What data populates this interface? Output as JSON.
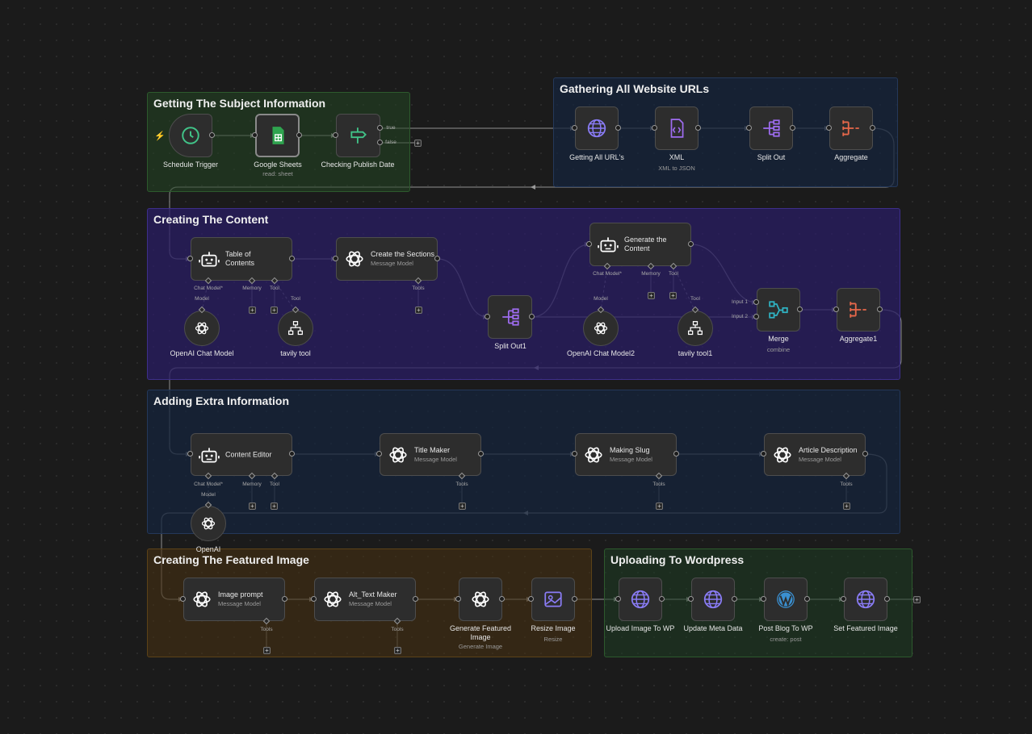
{
  "colors": {
    "canvas": "#1b1b1b",
    "wire": "#7a7a7a",
    "openai": "#ffffff",
    "http": "#8a7cf6",
    "sheets": "#2fa44f",
    "trigger": "#41c388",
    "filter": "#41c388",
    "split": "#9e6cf0",
    "aggregate": "#e8684a",
    "merge": "#2fb4c4"
  },
  "sections": {
    "subject": {
      "title": "Getting The Subject Information"
    },
    "urls": {
      "title": "Gathering All Website URLs"
    },
    "content": {
      "title": "Creating The Content"
    },
    "extra": {
      "title": "Adding Extra Information"
    },
    "image": {
      "title": "Creating The Featured Image"
    },
    "wordpress": {
      "title": "Uploading To Wordpress"
    }
  },
  "nodes": {
    "schedule": {
      "label": "Schedule Trigger",
      "icon": "clock-icon"
    },
    "sheets": {
      "label": "Google Sheets",
      "sub": "read: sheet",
      "icon": "google-sheets-icon"
    },
    "publish": {
      "label": "Checking Publish Date",
      "icon": "signpost-icon",
      "out_true": "true",
      "out_false": "false"
    },
    "get_urls": {
      "label": "Getting All URL's",
      "icon": "globe-icon"
    },
    "xml": {
      "label": "XML",
      "sub": "XML to JSON",
      "icon": "xml-icon"
    },
    "split1": {
      "label": "Split Out",
      "icon": "split-icon"
    },
    "aggregate": {
      "label": "Aggregate",
      "icon": "aggregate-icon"
    },
    "toc": {
      "label": "Table of Contents",
      "icon": "robot-icon"
    },
    "sections_node": {
      "label": "Create the Sections",
      "sub": "Message Model",
      "icon": "openai-icon"
    },
    "split2": {
      "label": "Split Out1",
      "icon": "split-icon"
    },
    "generate": {
      "label": "Generate the Content",
      "icon": "robot-icon"
    },
    "merge": {
      "label": "Merge",
      "sub": "combine",
      "input1": "Input 1",
      "input2": "Input 2",
      "icon": "merge-icon"
    },
    "aggregate1": {
      "label": "Aggregate1",
      "icon": "aggregate-icon"
    },
    "openai_chat": {
      "label": "OpenAI Chat Model",
      "icon": "openai-icon"
    },
    "tavily": {
      "label": "tavily tool",
      "icon": "sitemap-icon"
    },
    "openai_chat2": {
      "label": "OpenAI Chat Model2",
      "icon": "openai-icon"
    },
    "tavily1": {
      "label": "tavily tool1",
      "icon": "sitemap-icon"
    },
    "editor": {
      "label": "Content Editor",
      "icon": "robot-icon"
    },
    "title_maker": {
      "label": "Title Maker",
      "sub": "Message Model",
      "icon": "openai-icon"
    },
    "slug": {
      "label": "Making Slug",
      "sub": "Message Model",
      "icon": "openai-icon"
    },
    "description": {
      "label": "Article Description",
      "sub": "Message Model",
      "icon": "openai-icon"
    },
    "openai": {
      "label": "OpenAI",
      "icon": "openai-icon"
    },
    "img_prompt": {
      "label": "Image prompt",
      "sub": "Message Model",
      "icon": "openai-icon"
    },
    "alt_text": {
      "label": "Alt_Text Maker",
      "sub": "Message Model",
      "icon": "openai-icon"
    },
    "gen_image": {
      "label": "Generate Featured Image",
      "sub": "Generate Image",
      "icon": "openai-icon"
    },
    "resize": {
      "label": "Resize Image",
      "sub": "Resize",
      "icon": "image-icon"
    },
    "upload": {
      "label": "Upload Image To WP",
      "icon": "globe-icon"
    },
    "meta": {
      "label": "Update Meta Data",
      "icon": "globe-icon"
    },
    "post": {
      "label": "Post Blog To WP",
      "sub": "create: post",
      "icon": "wordpress-icon"
    },
    "featured": {
      "label": "Set Featured Image",
      "icon": "globe-icon"
    }
  },
  "ports": {
    "chat_model": "Chat Model*",
    "memory": "Memory",
    "tool": "Tool",
    "tools": "Tools",
    "model": "Model"
  }
}
